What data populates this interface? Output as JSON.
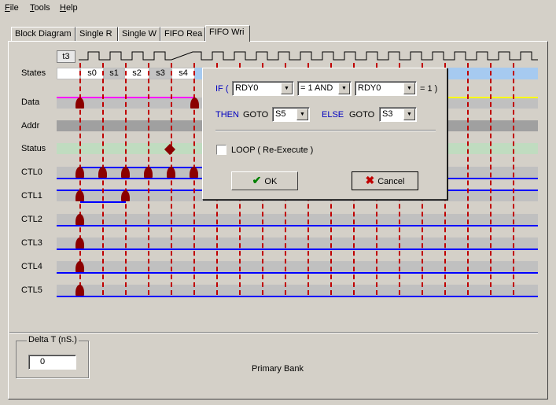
{
  "menu": {
    "file": "File",
    "tools": "Tools",
    "help": "Help"
  },
  "tabs": [
    "Block Diagram",
    "Single R",
    "Single W",
    "FIFO Rea",
    "FIFO Wri"
  ],
  "active_tab": "FIFO Wri",
  "timeline": {
    "current_state_label": "t3",
    "states": [
      "s0",
      "s1",
      "s2",
      "s3",
      "s4"
    ]
  },
  "rows": {
    "states": "States",
    "data": "Data",
    "addr": "Addr",
    "status": "Status",
    "ctl0": "CTL0",
    "ctl1": "CTL1",
    "ctl2": "CTL2",
    "ctl3": "CTL3",
    "ctl4": "CTL4",
    "ctl5": "CTL5"
  },
  "colors": {
    "data_line": "#ff00ff",
    "data_line_right": "#ffff00",
    "signal_line": "#0000ff",
    "marker": "#8b0000",
    "states_bar": "#a6caf0",
    "status_bar": "#c0dcc0"
  },
  "dialog": {
    "if_label": "IF (",
    "cond1": "RDY0",
    "operator": "= 1  AND",
    "cond2": "RDY0",
    "suffix": "= 1 )",
    "then_label": "THEN",
    "goto1": "GOTO",
    "then_state": "S5",
    "else_label": "ELSE",
    "goto2": "GOTO",
    "else_state": "S3",
    "loop_label": "LOOP  ( Re-Execute )",
    "ok_label": "OK",
    "cancel_label": "Cancel",
    "ok_icon": "checkmark-icon",
    "cancel_icon": "x-icon"
  },
  "delta_t": {
    "label": "Delta T (nS.)",
    "value": "0"
  },
  "bank_label": "Primary Bank"
}
